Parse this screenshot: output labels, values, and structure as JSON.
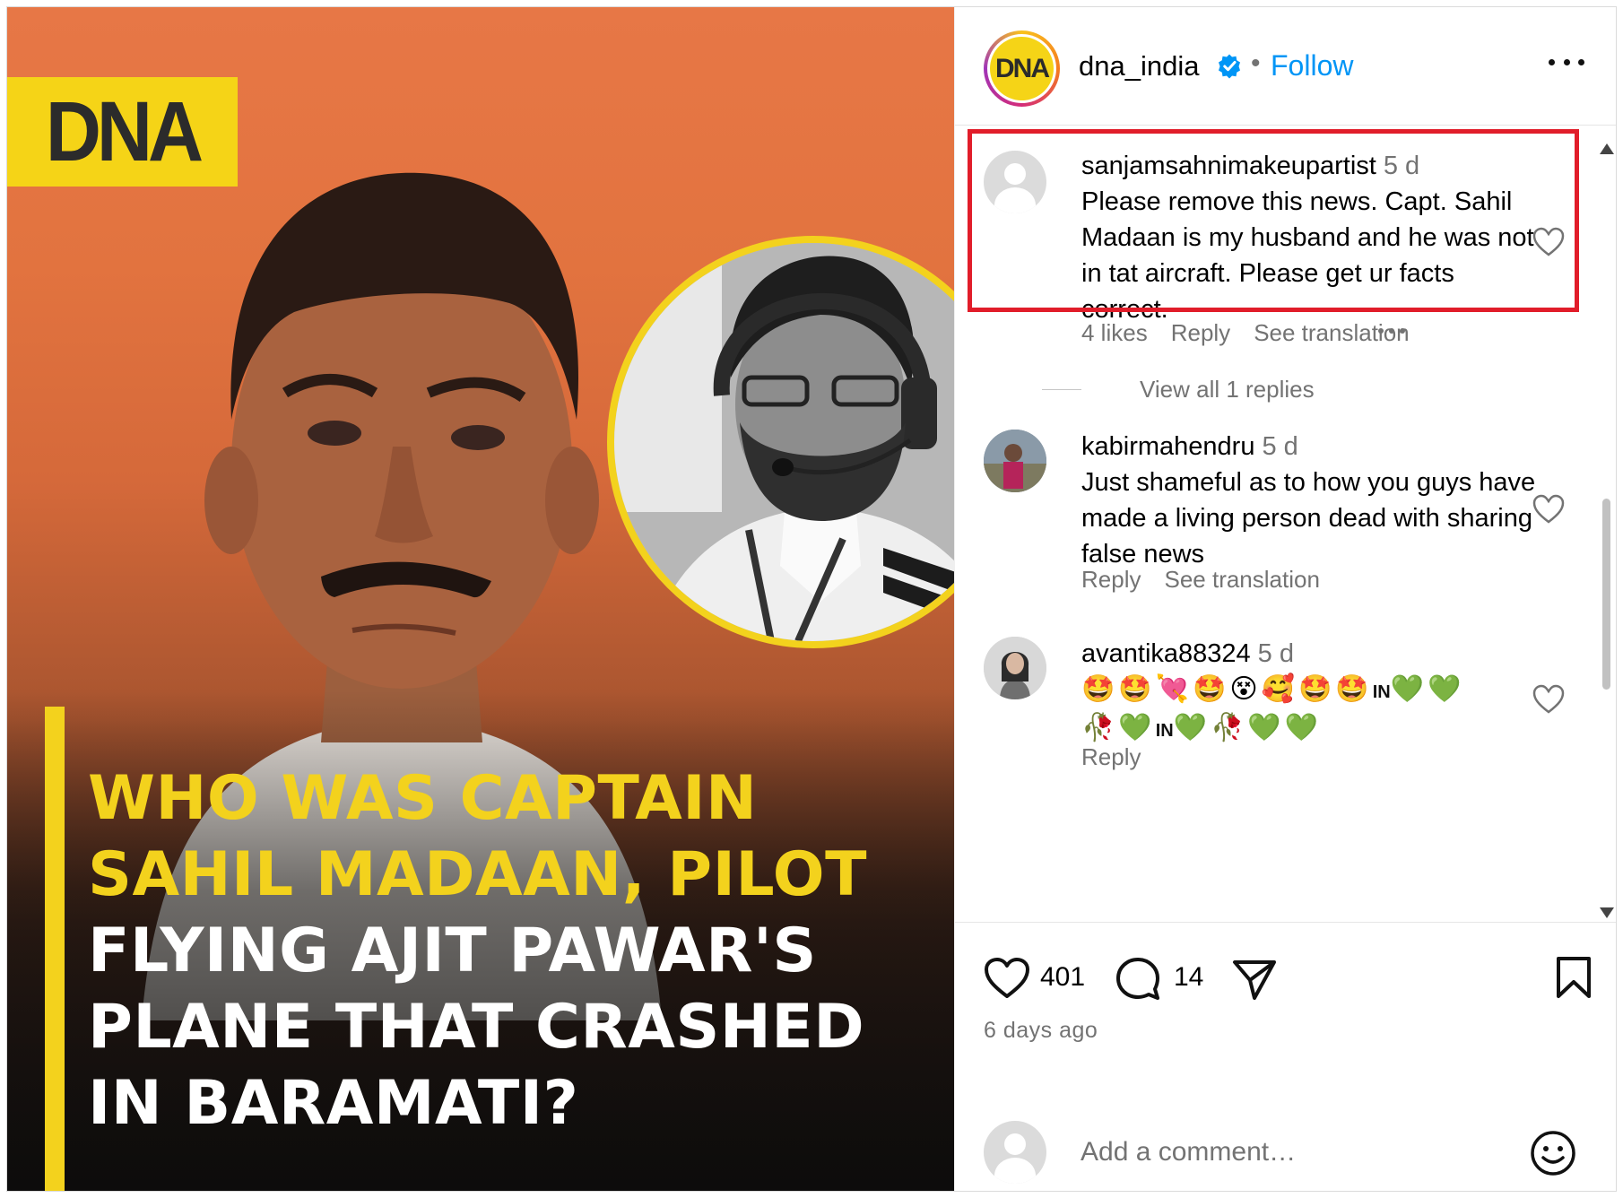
{
  "post_image": {
    "logo_text": "DNA",
    "headline_yellow": [
      "WHO WAS CAPTAIN",
      "SAHIL MADAAN, PILOT"
    ],
    "headline_white": [
      "FLYING AJIT PAWAR'S",
      "PLANE THAT CRASHED",
      "IN BARAMATI?"
    ]
  },
  "header": {
    "avatar_text": "DNA",
    "username": "dna_india",
    "separator": "•",
    "follow_label": "Follow"
  },
  "comments": [
    {
      "username": "sanjamsahnimakeupartist",
      "time": "5 d",
      "text": "Please remove this news. Capt. Sahil Madaan is my husband and he was not in tat aircraft. Please get ur facts correct.",
      "likes": "4 likes",
      "reply_label": "Reply",
      "translate_label": "See translation",
      "view_replies": "View all 1 replies"
    },
    {
      "username": "kabirmahendru",
      "time": "5 d",
      "text": "Just shameful as to how you guys have made a living person dead with sharing false news",
      "reply_label": "Reply",
      "translate_label": "See translation"
    },
    {
      "username": "avantika88324",
      "time": "5 d",
      "emoji_line1": "🤩🤩💘🤩😵🥰🤩🤩",
      "in_label": "IN",
      "hearts_line1": "💚💚",
      "emoji_line2a": "🥀💚",
      "emoji_line2b": "💚🥀💚💚",
      "reply_label": "Reply"
    }
  ],
  "actions": {
    "like_count": "401",
    "comment_count": "14",
    "posted": "6 days ago"
  },
  "add_comment": {
    "placeholder": "Add a comment…"
  },
  "colors": {
    "accent": "#0095f6",
    "highlight": "#e11d2a",
    "brand_yellow": "#f3d21d",
    "muted": "#737373"
  },
  "icons": [
    "verified-badge-icon",
    "more-options-icon",
    "heart-icon",
    "comment-icon",
    "share-icon",
    "bookmark-icon",
    "emoji-icon"
  ]
}
